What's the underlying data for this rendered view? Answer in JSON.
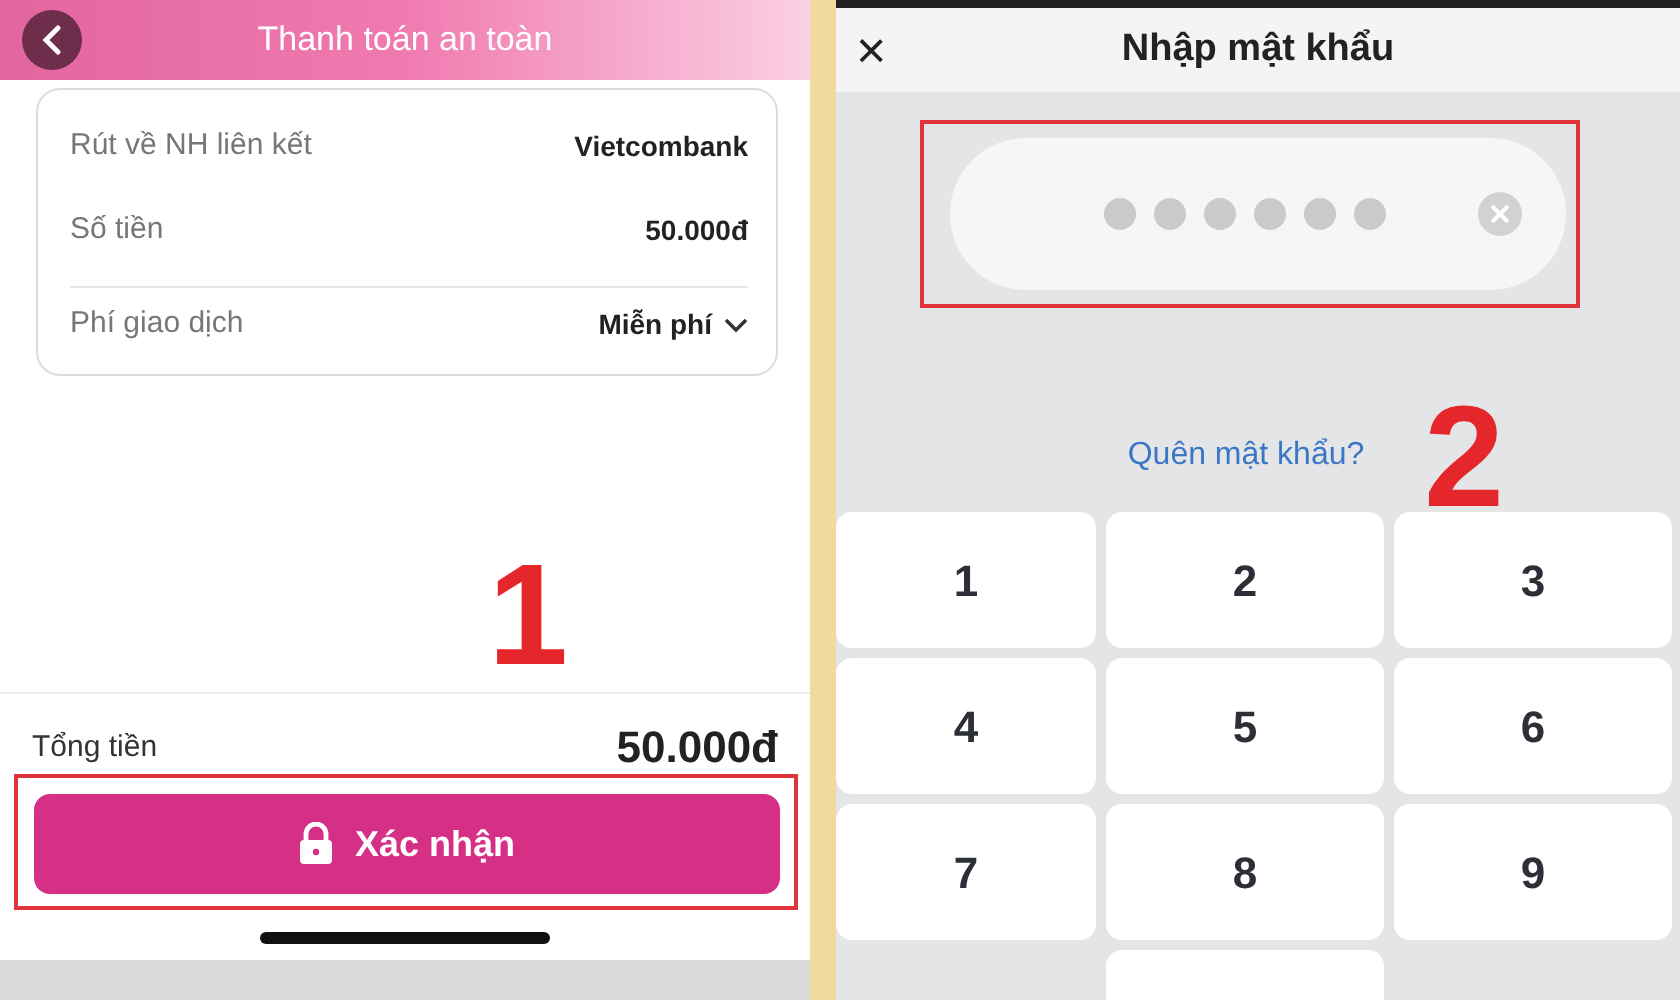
{
  "payment_screen": {
    "title": "Thanh toán an toàn",
    "details": [
      {
        "label": "Rút về NH liên kết",
        "value": "Vietcombank",
        "kind": "plain"
      },
      {
        "label": "Số tiền",
        "value": "50.000đ",
        "kind": "plain"
      },
      {
        "label": "Phí giao dịch",
        "value": "Miễn phí",
        "kind": "dropdown"
      }
    ],
    "total": {
      "label": "Tổng tiền",
      "value": "50.000đ"
    },
    "confirm_button": "Xác nhận",
    "step_number": "1"
  },
  "password_screen": {
    "close": "×",
    "title": "Nhập mật khẩu",
    "pin_dots": [
      {
        "filled": false
      },
      {
        "filled": false
      },
      {
        "filled": false
      },
      {
        "filled": false
      },
      {
        "filled": false
      },
      {
        "filled": false
      }
    ],
    "forgot_link": "Quên mật khẩu?",
    "step_number": "2",
    "keys": [
      "1",
      "2",
      "3",
      "4",
      "5",
      "6",
      "7",
      "8",
      "9"
    ]
  }
}
